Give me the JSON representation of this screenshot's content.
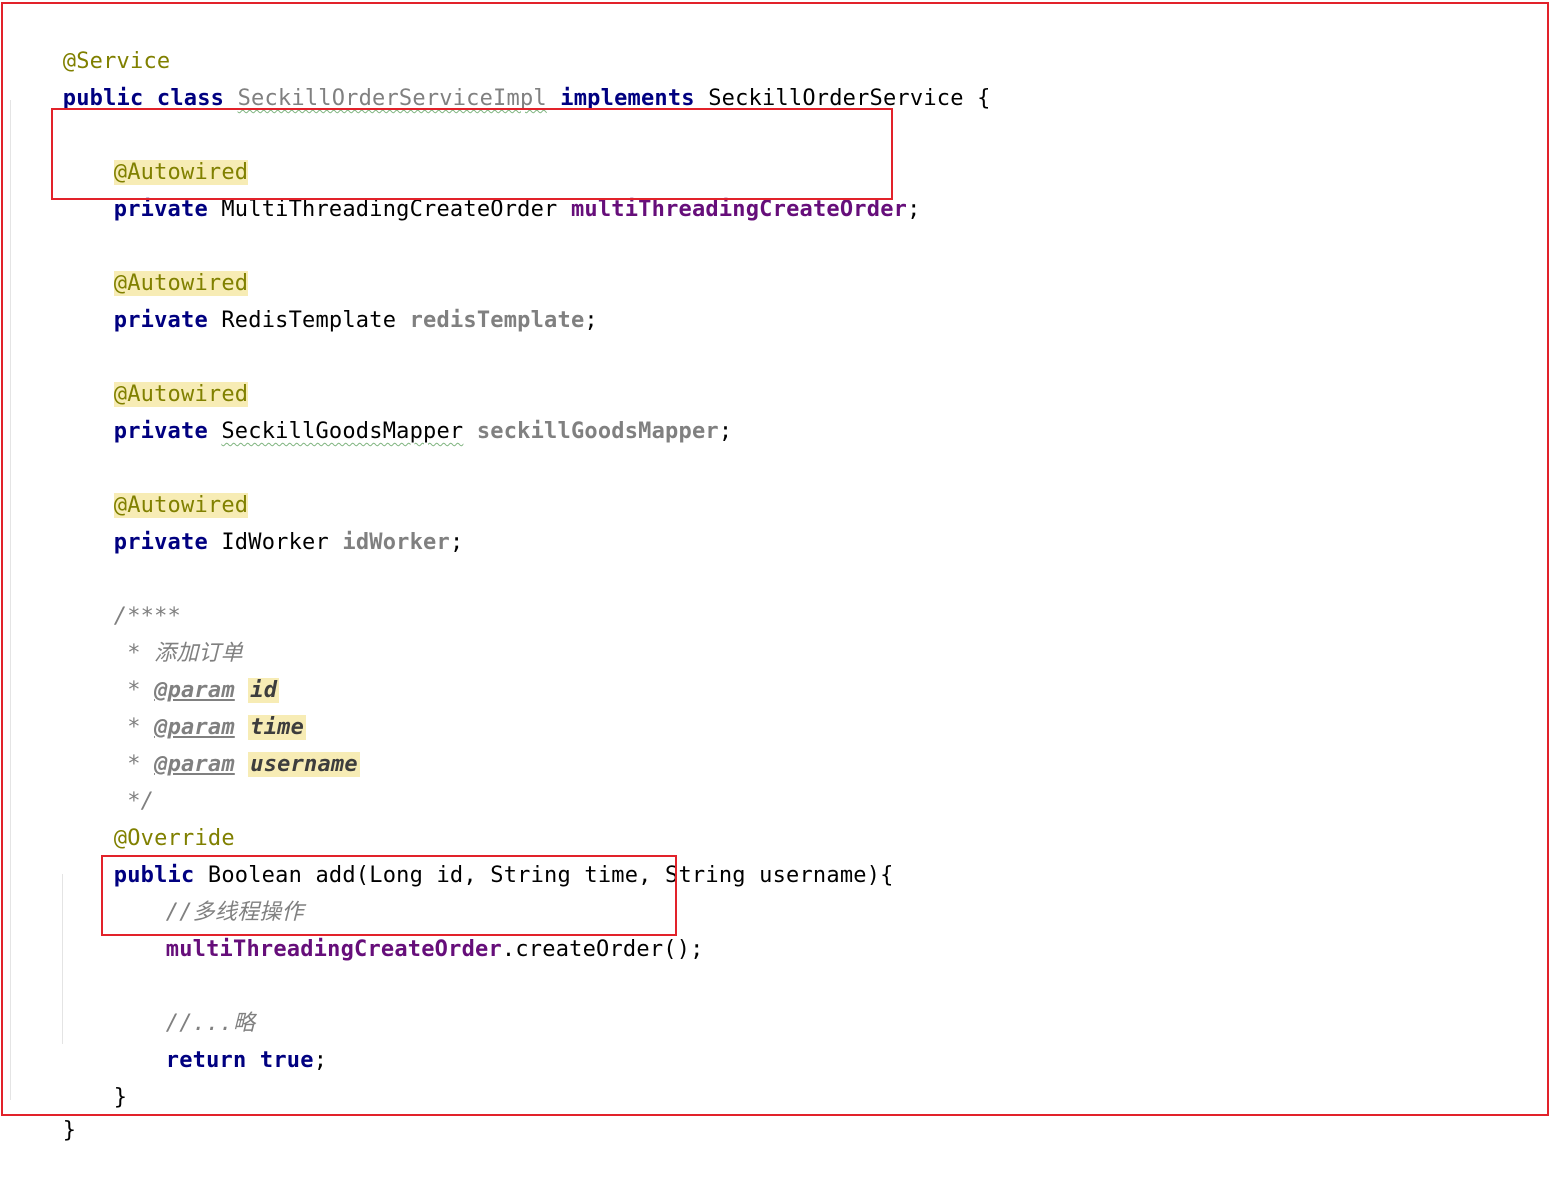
{
  "code": {
    "l1_annotation": "@Service",
    "l2_public": "public",
    "l2_class": "class",
    "l2_classname": "SeckillOrderServiceImpl",
    "l2_implements": "implements",
    "l2_interface": "SeckillOrderService",
    "l2_brace": "{",
    "f1_annotation": "@Autowired",
    "f1_private": "private",
    "f1_type": "MultiThreadingCreateOrder",
    "f1_name": "multiThreadingCreateOrder",
    "f1_semi": ";",
    "f2_annotation": "@Autowired",
    "f2_private": "private",
    "f2_type": "RedisTemplate",
    "f2_name": "redisTemplate",
    "f2_semi": ";",
    "f3_annotation": "@Autowired",
    "f3_private": "private",
    "f3_type": "SeckillGoodsMapper",
    "f3_name": "seckillGoodsMapper",
    "f3_semi": ";",
    "f4_annotation": "@Autowired",
    "f4_private": "private",
    "f4_type": "IdWorker",
    "f4_name": "idWorker",
    "f4_semi": ";",
    "doc_open": "/****",
    "doc_desc": " * 添加订单",
    "doc_star": " * ",
    "doc_param_tag": "@param",
    "doc_param1": "id",
    "doc_param2": "time",
    "doc_param3": "username",
    "doc_close": " */",
    "override": "@Override",
    "m_public": "public",
    "m_signature": "Boolean add(Long id, String time, String username){",
    "body_comment1": "//多线程操作",
    "body_call_field": "multiThreadingCreateOrder",
    "body_call_rest": ".createOrder();",
    "body_comment2": "//...略",
    "body_return": "return",
    "body_true": "true",
    "body_return_semi": ";",
    "m_close": "}",
    "class_close": "}"
  }
}
